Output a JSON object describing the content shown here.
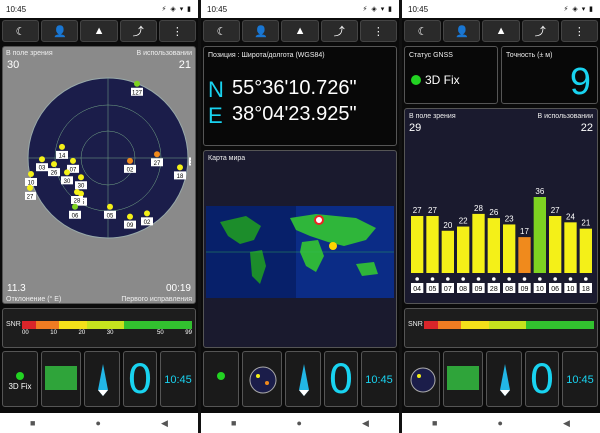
{
  "status": {
    "time": "10:45",
    "icons": "⚡ ◈ ▾ ▮"
  },
  "toolbar": [
    "☾",
    "👤",
    "▲",
    "⤴",
    "⋮"
  ],
  "nav": [
    "■",
    "●",
    "◀"
  ],
  "sky": {
    "in_view_label": "В поле зрения",
    "in_view": "30",
    "in_use_label": "В использовании",
    "in_use": "21",
    "declination": "11.3",
    "declination_label": "Отклонение (° E)",
    "ttff": "00:19",
    "ttff_label": "Первого исправления",
    "satellites": [
      "127",
      "27",
      "14",
      "03",
      "26",
      "07",
      "30",
      "02",
      "05",
      "18",
      "10",
      "27",
      "28",
      "06",
      "05",
      "09",
      "02",
      "194",
      "30"
    ]
  },
  "position": {
    "label": "Позиция : Широта/долгота (WGS84)",
    "lat_dir": "N",
    "lat": "55°36'10.726\"",
    "lon_dir": "E",
    "lon": "38°04'23.925\""
  },
  "worldmap": {
    "label": "Карта мира"
  },
  "gnss": {
    "status_label": "Статус GNSS",
    "fix": "3D Fix",
    "accuracy_label": "Точность (± м)",
    "accuracy": "9",
    "in_view_label": "В поле зрения",
    "in_view": "29",
    "in_use_label": "В использовании",
    "in_use": "22"
  },
  "bars": {
    "values": [
      27,
      27,
      20,
      22,
      28,
      26,
      23,
      17,
      36,
      27,
      24,
      21
    ],
    "ids": [
      "04",
      "05",
      "07",
      "08",
      "09",
      "28",
      "08",
      "09",
      "10",
      "06",
      "10",
      "18"
    ],
    "colors": [
      "#f4f018",
      "#f4f018",
      "#f4f018",
      "#f4f018",
      "#f4f018",
      "#f4f018",
      "#f4f018",
      "#f08a1c",
      "#7ed321",
      "#f4f018",
      "#f4f018",
      "#f4f018"
    ]
  },
  "snr": {
    "label": "SNR",
    "ticks": [
      "00",
      "10",
      "20",
      "30",
      "50",
      "99"
    ]
  },
  "tiles": {
    "fix": "3D Fix",
    "zero": "0",
    "time": "10:45"
  }
}
